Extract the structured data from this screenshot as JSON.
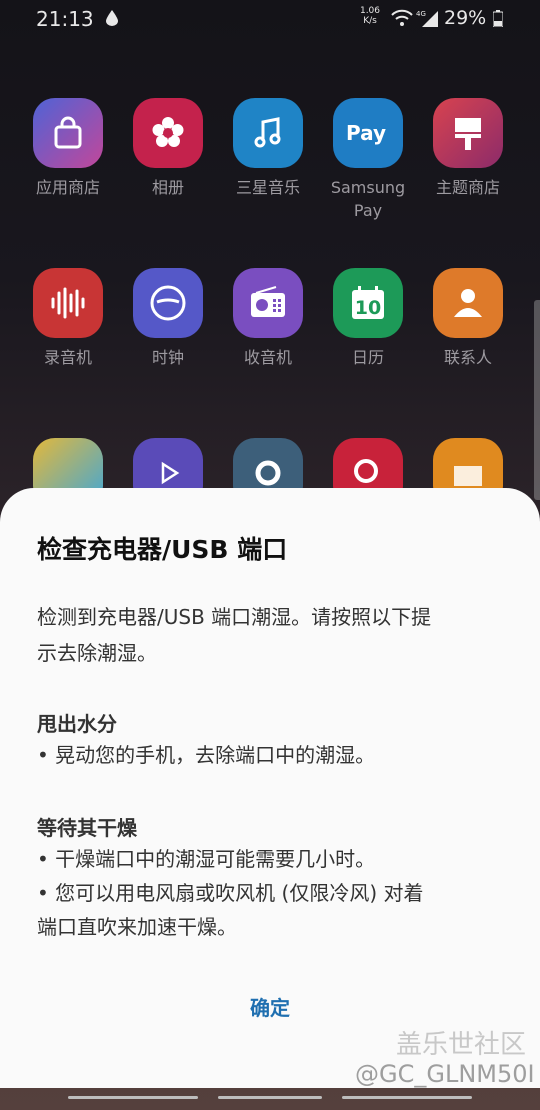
{
  "status": {
    "time": "21:13",
    "speed_value": "1.06",
    "speed_unit": "K/s",
    "network": "4G",
    "battery": "29%"
  },
  "apps": [
    {
      "label": "应用商店",
      "icon": "store-bag-icon",
      "color": "#5b5fd6"
    },
    {
      "label": "相册",
      "icon": "flower-icon",
      "color": "#c7234e"
    },
    {
      "label": "三星音乐",
      "icon": "music-note-icon",
      "color": "#1f86c9"
    },
    {
      "label": "Samsung Pay",
      "icon": "pay-icon",
      "color": "#1f7fc7"
    },
    {
      "label": "主题商店",
      "icon": "paintbrush-icon",
      "color": "#c43a5c"
    },
    {
      "label": "录音机",
      "icon": "waveform-icon",
      "color": "#d43838"
    },
    {
      "label": "时钟",
      "icon": "clock-icon",
      "color": "#5a5fcf"
    },
    {
      "label": "收音机",
      "icon": "radio-icon",
      "color": "#7b4fc2"
    },
    {
      "label": "日历",
      "icon": "calendar-icon",
      "color": "#1f9b5a",
      "value": "10"
    },
    {
      "label": "联系人",
      "icon": "contact-icon",
      "color": "#e07a2b"
    }
  ],
  "dialog": {
    "title": "检查充电器/USB 端口",
    "intro_line1": "检测到充电器/USB 端口潮湿。请按照以下提",
    "intro_line2": "示去除潮湿。",
    "section1_title": "甩出水分",
    "section1_item1": "• 晃动您的手机，去除端口中的潮湿。",
    "section2_title": "等待其干燥",
    "section2_item1": "• 干燥端口中的潮湿可能需要几小时。",
    "section2_item2_line1": "• 您可以用电风扇或吹风机 (仅限冷风) 对着",
    "section2_item2_line2": "端口直吹来加速干燥。",
    "ok_label": "确定"
  },
  "watermark": {
    "site": "盖乐世社区",
    "user": "@GC_GLNM50I"
  }
}
